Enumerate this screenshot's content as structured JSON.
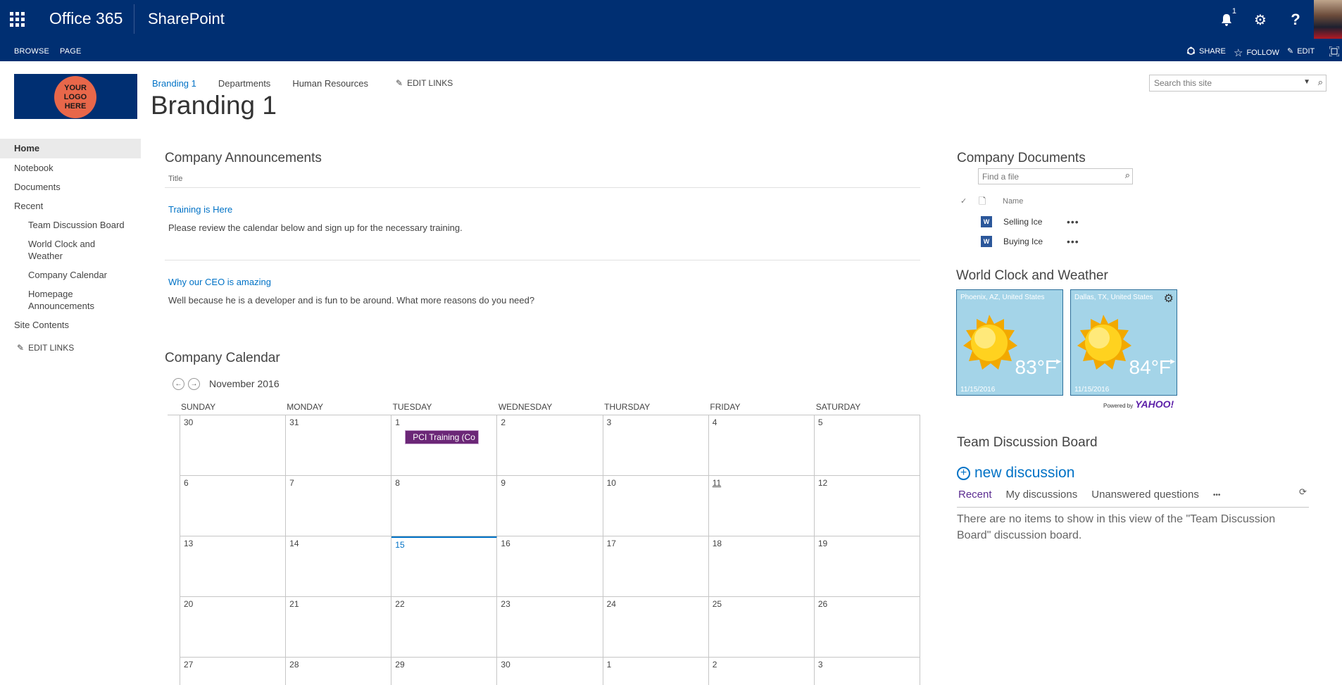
{
  "suite": {
    "brand": "Office 365",
    "app": "SharePoint",
    "notification_count": "1"
  },
  "ribbon": {
    "tabs": [
      "BROWSE",
      "PAGE"
    ],
    "share": "SHARE",
    "follow": "FOLLOW",
    "edit": "EDIT"
  },
  "header": {
    "logo_text": "YOUR LOGO HERE",
    "topnav": [
      "Branding 1",
      "Departments",
      "Human Resources"
    ],
    "edit_links": "EDIT LINKS",
    "title": "Branding 1",
    "search_placeholder": "Search this site"
  },
  "leftnav": {
    "items": [
      "Home",
      "Notebook",
      "Documents",
      "Recent"
    ],
    "recent": [
      "Team Discussion Board",
      "World Clock and Weather",
      "Company Calendar",
      "Homepage Announcements"
    ],
    "site_contents": "Site Contents",
    "edit_links": "EDIT LINKS"
  },
  "announcements": {
    "title": "Company Announcements",
    "column": "Title",
    "items": [
      {
        "title": "Training is Here",
        "body": "Please review the calendar below and sign up for the necessary training."
      },
      {
        "title": "Why our CEO is amazing",
        "body": "Well because he is a developer and is fun to be around. What more reasons do you need?"
      }
    ]
  },
  "calendar": {
    "title": "Company Calendar",
    "month": "November 2016",
    "days": [
      "SUNDAY",
      "MONDAY",
      "TUESDAY",
      "WEDNESDAY",
      "THURSDAY",
      "FRIDAY",
      "SATURDAY"
    ],
    "dates": [
      "30",
      "31",
      "1",
      "2",
      "3",
      "4",
      "5",
      "6",
      "7",
      "8",
      "9",
      "10",
      "11",
      "12",
      "13",
      "14",
      "15",
      "16",
      "17",
      "18",
      "19",
      "20",
      "21",
      "22",
      "23",
      "24",
      "25",
      "26",
      "27",
      "28",
      "29",
      "30",
      "1",
      "2",
      "3"
    ],
    "today": "15",
    "event": {
      "label": "PCI Training (Co",
      "date": "1"
    }
  },
  "documents": {
    "title": "Company Documents",
    "find_placeholder": "Find a file",
    "column": "Name",
    "files": [
      "Selling Ice",
      "Buying Ice"
    ],
    "file_icon": "W"
  },
  "weather": {
    "title": "World Clock and Weather",
    "tiles": [
      {
        "city": "Phoenix, AZ, United States",
        "temp": "83°F",
        "date": "11/15/2016"
      },
      {
        "city": "Dallas, TX, United States",
        "temp": "84°F",
        "date": "11/15/2016"
      }
    ],
    "powered": "Powered by",
    "provider": "YAHOO!"
  },
  "discussion": {
    "title": "Team Discussion Board",
    "new": "new discussion",
    "tabs": [
      "Recent",
      "My discussions",
      "Unanswered questions",
      "•••"
    ],
    "empty": "There are no items to show in this view of the \"Team Discussion Board\" discussion board."
  },
  "colors": {
    "suite": "#002f72",
    "link": "#0072c6",
    "event": "#6b2777"
  }
}
